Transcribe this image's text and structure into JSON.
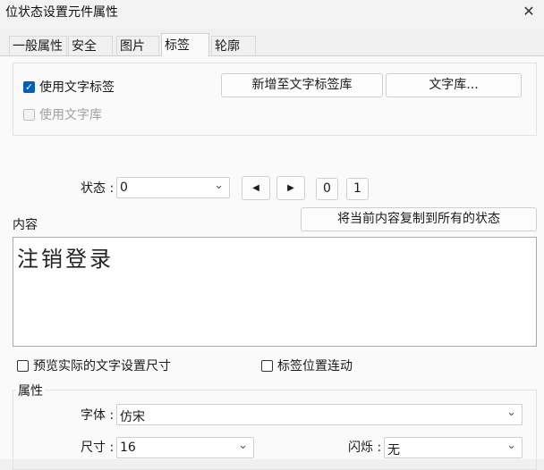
{
  "window": {
    "title": "位状态设置元件属性",
    "close_label": "✕"
  },
  "tabs": [
    {
      "label": "一般属性"
    },
    {
      "label": "安全"
    },
    {
      "label": "图片"
    },
    {
      "label": "标签",
      "active": true
    },
    {
      "label": "轮廓"
    }
  ],
  "label_group": {
    "use_text_label": {
      "label": "使用文字标签",
      "checked": true
    },
    "use_text_library": {
      "label": "使用文字库",
      "checked": false,
      "disabled": true
    },
    "add_to_library_button": "新增至文字标签库",
    "text_library_button": "文字库..."
  },
  "state": {
    "label": "状态 :",
    "value": "0",
    "prev_glyph": "◀",
    "next_glyph": "▶",
    "buttons": [
      "0",
      "1"
    ]
  },
  "content": {
    "label": "内容",
    "copy_button": "将当前内容复制到所有的状态",
    "text": "注销登录"
  },
  "options": {
    "preview_actual_size": {
      "label": "预览实际的文字设置尺寸",
      "checked": false
    },
    "label_position_linked": {
      "label": "标签位置连动",
      "checked": false
    }
  },
  "attributes": {
    "group_label": "属性",
    "font": {
      "label": "字体 :",
      "value": "仿宋"
    },
    "size": {
      "label": "尺寸 :",
      "value": "16"
    },
    "blink": {
      "label": "闪烁 :",
      "value": "无"
    }
  },
  "colors": {
    "accent": "#005fb8",
    "panel": "#fafafa",
    "window": "#f0f0f0"
  }
}
